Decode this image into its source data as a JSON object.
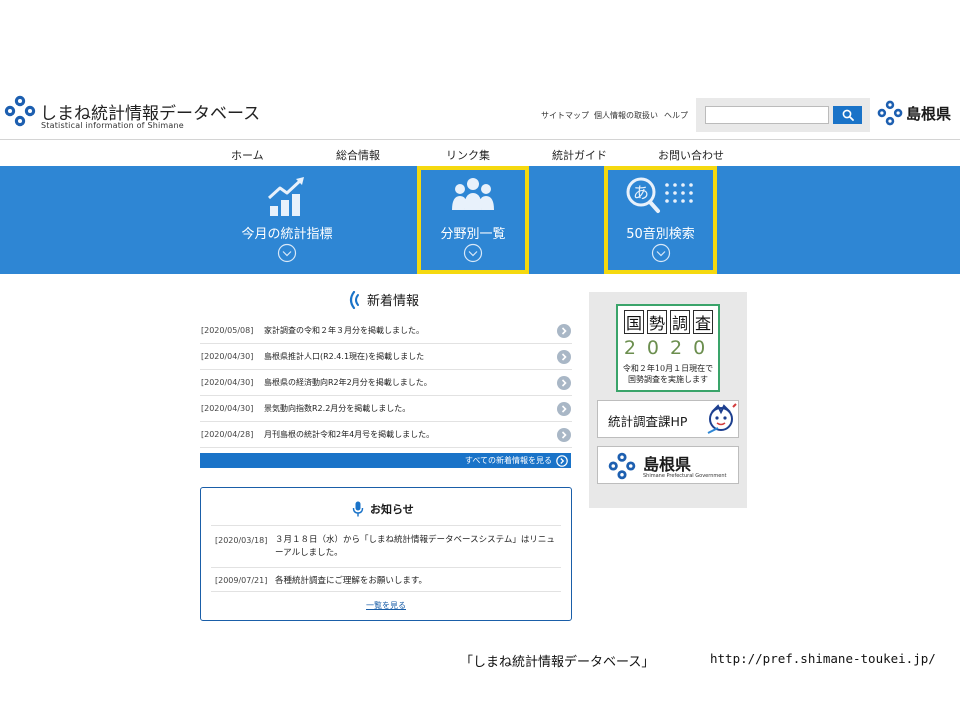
{
  "header": {
    "site_title": "しまね統計情報データベース",
    "site_subtitle": "Statistical information of Shimane",
    "links": [
      {
        "label": "サイトマップ"
      },
      {
        "label": "個人情報の取扱い"
      },
      {
        "label": "ヘルプ"
      }
    ],
    "search": {
      "value": "",
      "placeholder": ""
    },
    "pref_name": "島根県"
  },
  "nav": {
    "items": [
      {
        "label": "ホーム"
      },
      {
        "label": "総合情報"
      },
      {
        "label": "リンク集"
      },
      {
        "label": "統計ガイド"
      },
      {
        "label": "お問い合わせ"
      }
    ]
  },
  "features": [
    {
      "label": "今月の統計指標",
      "icon": "chart-up-icon",
      "highlighted": false
    },
    {
      "label": "分野別一覧",
      "icon": "people-group-icon",
      "highlighted": true
    },
    {
      "label": "50音別検索",
      "icon": "kana-search-icon",
      "highlighted": true
    }
  ],
  "news": {
    "heading": "新着情報",
    "items": [
      {
        "date": "[2020/05/08]",
        "text": "家計調査の令和２年３月分を掲載しました。"
      },
      {
        "date": "[2020/04/30]",
        "text": "島根県推計人口(R2.4.1現在)を掲載しました"
      },
      {
        "date": "[2020/04/30]",
        "text": "島根県の経済動向R2年2月分を掲載しました。"
      },
      {
        "date": "[2020/04/30]",
        "text": "景気動向指数R2.2月分を掲載しました。"
      },
      {
        "date": "[2020/04/28]",
        "text": "月刊島根の統計令和2年4月号を掲載しました。"
      }
    ],
    "all_link": "すべての新着情報を見る"
  },
  "notice": {
    "heading": "お知らせ",
    "items": [
      {
        "date": "[2020/03/18]",
        "text": "３月１８日（水）から「しまね統計情報データベースシステム」はリニューアルしました。"
      },
      {
        "date": "[2009/07/21]",
        "text": "各種統計調査にご理解をお願いします。"
      }
    ],
    "more_link": "一覧を見る"
  },
  "banners": {
    "census": {
      "title": [
        "国",
        "勢",
        "調",
        "査"
      ],
      "year": "2020",
      "caption_lines": [
        "令和２年10月１日現在で",
        "国勢調査を実施します"
      ]
    },
    "stat_division": {
      "label": "統計調査課HP"
    },
    "prefecture": {
      "name": "島根県",
      "subtitle": "Shimane Prefectural Government"
    }
  },
  "footer": {
    "caption": "「しまね統計情報データベース」",
    "url": "http://pref.shimane-toukei.jp/"
  },
  "colors": {
    "band_blue": "#2e86d4",
    "button_blue": "#1a73c8",
    "highlight_yellow": "#f5d90f",
    "census_green": "#3aa46a"
  }
}
